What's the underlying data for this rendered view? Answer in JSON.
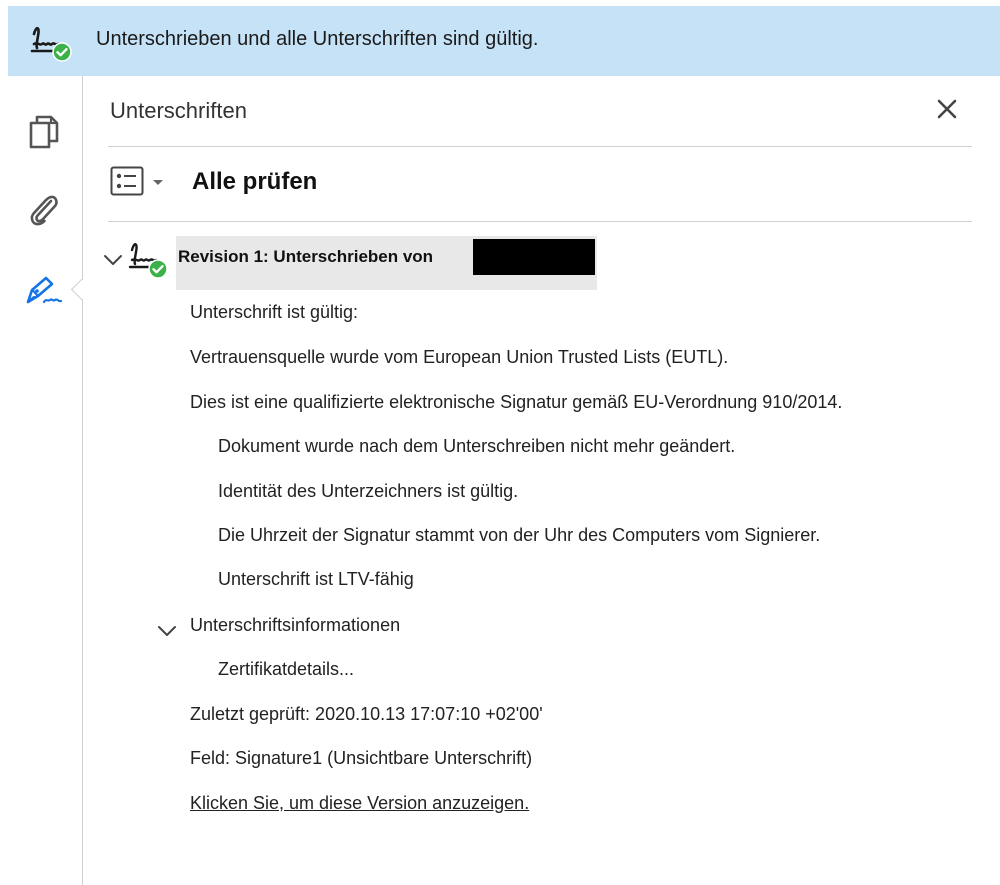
{
  "banner": {
    "text": "Unterschrieben und alle Unterschriften sind gültig.",
    "icon": "signature-valid-icon"
  },
  "rail": {
    "items": [
      {
        "name": "pages",
        "icon": "page-thumbnails-icon"
      },
      {
        "name": "attachments",
        "icon": "paperclip-icon"
      },
      {
        "name": "signatures",
        "icon": "signature-pen-icon",
        "active": true
      }
    ]
  },
  "panel": {
    "title": "Unterschriften",
    "verify_all_label": "Alle prüfen",
    "close_icon": "close-icon"
  },
  "revision": {
    "label": "Revision 1: Unterschrieben von",
    "expanded": true,
    "lines": [
      "Unterschrift ist gültig:",
      "Vertrauensquelle wurde vom European Union Trusted Lists (EUTL).",
      "Dies ist eine qualifizierte elektronische Signatur gemäß EU-Verordnung 910/2014."
    ],
    "sub_lines": [
      "Dokument wurde nach dem Unterschreiben nicht mehr geändert.",
      "Identität des Unterzeichners ist gültig.",
      "Die Uhrzeit der Signatur stammt von der Uhr des Computers vom Signierer.",
      "Unterschrift ist LTV-fähig"
    ],
    "info_section": {
      "label": "Unterschriftsinformationen",
      "expanded": true,
      "items": [
        "Zertifikatdetails..."
      ]
    },
    "last_checked": "Zuletzt geprüft: 2020.10.13 17:07:10 +02'00'",
    "field": "Feld: Signature1 (Unsichtbare Unterschrift)",
    "view_version_link": "Klicken Sie, um diese Version anzuzeigen."
  },
  "colors": {
    "banner_bg": "#c6e2f7",
    "valid_green": "#3cb14a",
    "accent_blue": "#1473e6",
    "highlight_bg": "#e8e8e8"
  }
}
